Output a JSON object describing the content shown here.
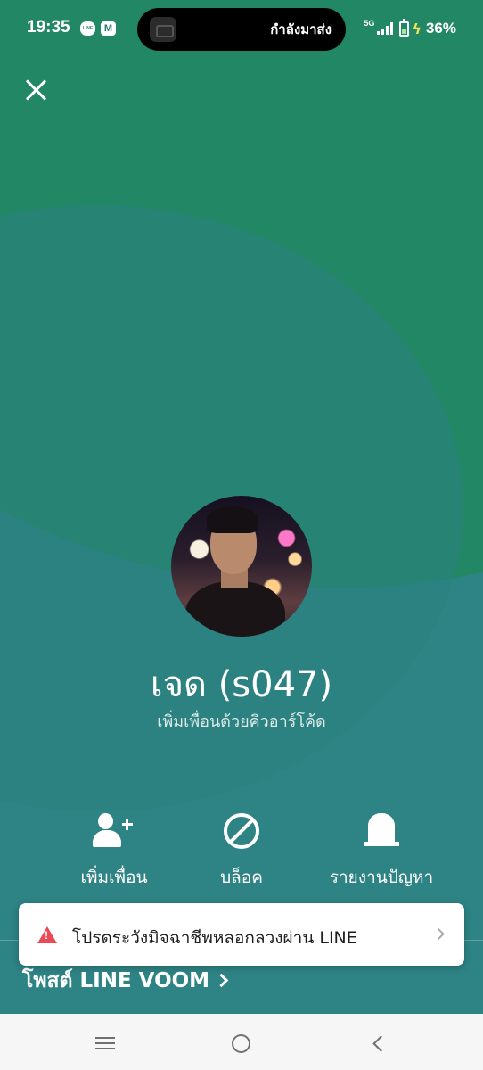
{
  "status_bar": {
    "time": "19:35",
    "app_icons": [
      "line-icon",
      "message-icon"
    ],
    "line_icon_text": "LINE",
    "message_icon_text": "M",
    "island_text": "กำลังมาส่ง",
    "network": "5G",
    "battery_percent": "36%"
  },
  "profile": {
    "name": "เจด (s047)",
    "add_by_qr": "เพิ่มเพื่อนด้วยคิวอาร์โค้ด"
  },
  "actions": {
    "add_friend": "เพิ่มเพื่อน",
    "block": "บล็อค",
    "report": "รายงานปัญหา"
  },
  "voom": {
    "label": "โพสต์ LINE VOOM"
  },
  "warning": {
    "text": "โปรดระวังมิจฉาชีพหลอกลวงผ่าน LINE",
    "color": "#e84a56"
  },
  "colors": {
    "green": "#228764",
    "teal": "#2e8384"
  },
  "nav": {
    "icons": [
      "recents-icon",
      "home-icon",
      "back-icon"
    ]
  }
}
